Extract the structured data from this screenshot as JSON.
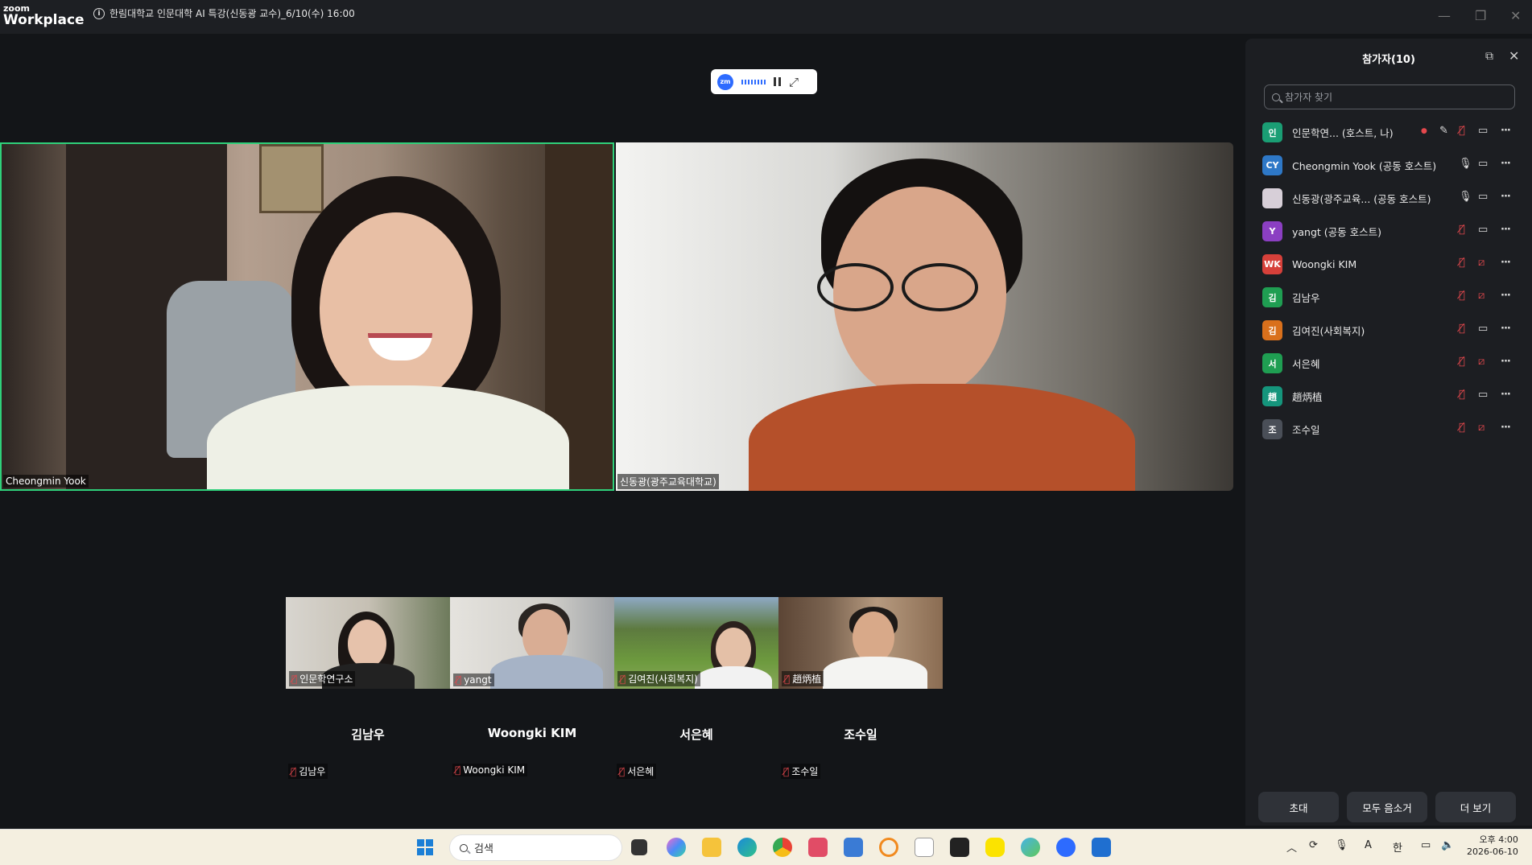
{
  "titlebar": {
    "logo_top": "zoom",
    "logo_bottom": "Workplace",
    "meeting_title": "한림대학교 인문대학 AI 특강(신동광 교수)_6/10(수) 16:00"
  },
  "main_videos": [
    {
      "name": "Cheongmin Yook"
    },
    {
      "name": "신동광(광주교육대학교)"
    }
  ],
  "small_videos": [
    {
      "name": "인문학연구소"
    },
    {
      "name": "yangt"
    },
    {
      "name": "김여진(사회복지)"
    },
    {
      "name": "趙炳植"
    }
  ],
  "no_video_tiles": [
    {
      "name": "김남우",
      "label": "김남우"
    },
    {
      "name": "Woongki KIM",
      "label": "Woongki KIM"
    },
    {
      "name": "서은혜",
      "label": "서은혜"
    },
    {
      "name": "조수일",
      "label": "조수일"
    }
  ],
  "participants_panel": {
    "title": "참가자(10)",
    "search_placeholder": "참가자 찾기",
    "participants": [
      {
        "avatar": "인",
        "color": "#1a9e74",
        "name": "인문학연...   (호스트, 나)",
        "mic": "off",
        "cam": "on",
        "recording": true
      },
      {
        "avatar": "CY",
        "color": "#2e78c7",
        "name": "Cheongmin Yook (공동 호스트)",
        "mic": "on",
        "cam": "on"
      },
      {
        "avatar": "",
        "color": "#d7cfd8",
        "name": "신동광(광주교육...   (공동 호스트)",
        "mic": "on",
        "cam": "on"
      },
      {
        "avatar": "Y",
        "color": "#8b3fc2",
        "name": "yangt (공동 호스트)",
        "mic": "off",
        "cam": "on"
      },
      {
        "avatar": "WK",
        "color": "#d6403a",
        "name": "Woongki KIM",
        "mic": "off",
        "cam": "off"
      },
      {
        "avatar": "김",
        "color": "#1f9e52",
        "name": "김남우",
        "mic": "off",
        "cam": "off"
      },
      {
        "avatar": "김",
        "color": "#d9701c",
        "name": "김여진(사회복지)",
        "mic": "off",
        "cam": "on"
      },
      {
        "avatar": "서",
        "color": "#1f9e52",
        "name": "서은혜",
        "mic": "off",
        "cam": "off"
      },
      {
        "avatar": "趙",
        "color": "#15957c",
        "name": "趙炳植",
        "mic": "off",
        "cam": "on"
      },
      {
        "avatar": "조",
        "color": "#4a4f58",
        "name": "조수일",
        "mic": "off",
        "cam": "off"
      }
    ],
    "buttons": {
      "invite": "초대",
      "mute_all": "모두 음소거",
      "more": "더 보기"
    }
  },
  "taskbar": {
    "search_label": "검색",
    "ime_a": "A",
    "ime_han": "한",
    "time": "오후 4:00",
    "date": "2026-06-10"
  }
}
